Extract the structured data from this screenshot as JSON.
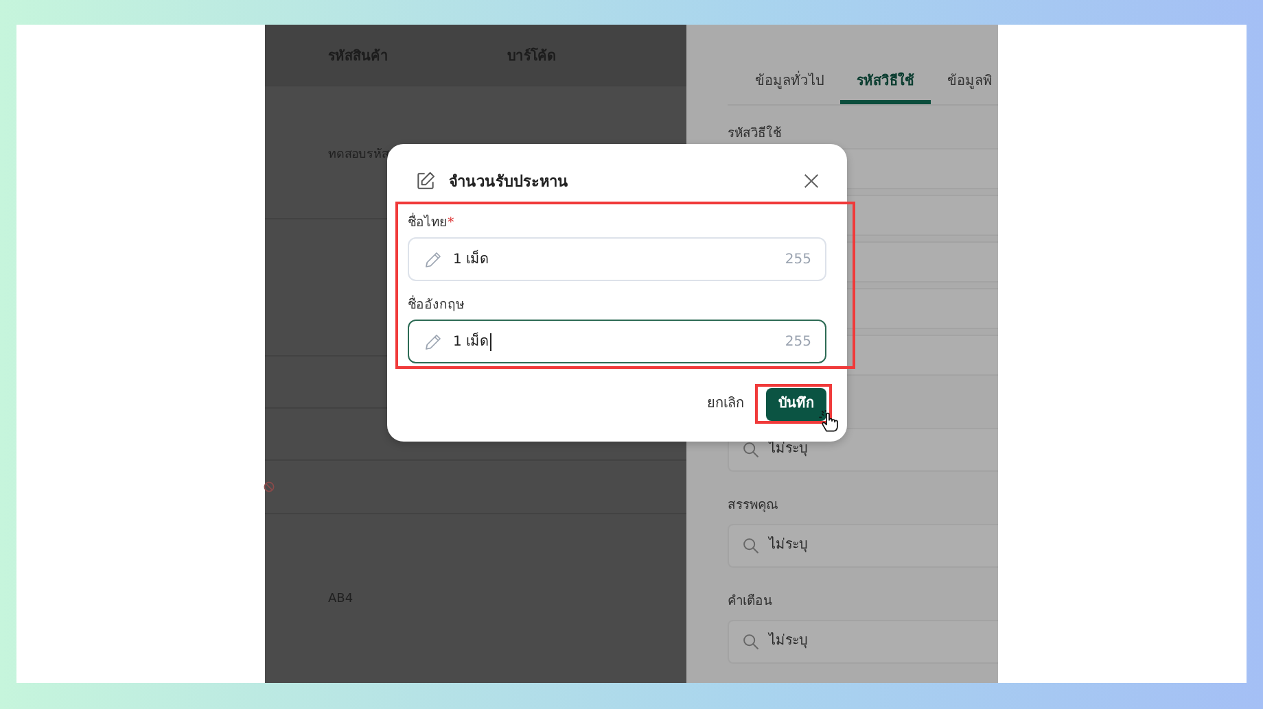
{
  "table": {
    "columns": [
      "รหัสสินค้า",
      "บาร์โค้ด"
    ],
    "rows": [
      {
        "code": "ทดสอบรหัส",
        "blocked": false
      },
      {
        "blocked": false
      },
      {
        "blocked": false
      },
      {
        "blocked": false
      },
      {
        "blocked": true
      },
      {
        "code": "AB4",
        "blocked": false
      }
    ]
  },
  "detail_panel": {
    "tabs": [
      {
        "label": "ข้อมูลทั่วไป",
        "selected": false
      },
      {
        "label": "รหัสวิธีใช้",
        "selected": true
      },
      {
        "label": "ข้อมูลพิ",
        "selected": false
      }
    ],
    "section_label": "รหัสวิธีใช้",
    "search_fields": [
      {
        "placeholder": "ไม่ระบุ"
      },
      {
        "label": "สรรพคุณ",
        "placeholder": "ไม่ระบุ"
      },
      {
        "label": "คำเตือน",
        "placeholder": "ไม่ระบุ"
      }
    ]
  },
  "dialog": {
    "title": "จำนวนรับประหาน",
    "fields": [
      {
        "label": "ชื่อไทย",
        "required_mark": "*",
        "value": "1 เม็ด",
        "counter": "255",
        "focused": false
      },
      {
        "label": "ชื่ออังกฤษ",
        "value": "1 เม็ด",
        "counter": "255",
        "focused": true
      }
    ],
    "buttons": [
      {
        "label": "ยกเลิก",
        "kind": "text"
      },
      {
        "label": "บันทึก",
        "kind": "primary"
      }
    ]
  }
}
